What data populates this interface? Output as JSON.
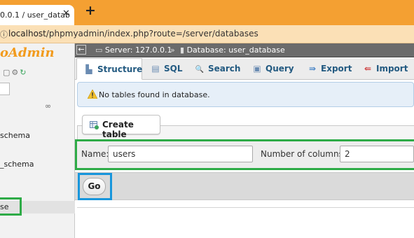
{
  "browser": {
    "tab_title": "0.0.1 / user_datab",
    "tab_close": "✕",
    "new_tab": "+",
    "url_icon": "ⓘ",
    "url_host": "localhost",
    "url_path": "/phpmyadmin/index.php?route=/server/databases"
  },
  "sidebar": {
    "logo": "oAdmin",
    "databases": [
      {
        "label": "schema"
      },
      {
        "label": "_schema"
      },
      {
        "label": "se",
        "selected": true
      }
    ]
  },
  "breadcrumb": {
    "collapse": "←",
    "server": "Server: 127.0.0.1",
    "sep": "»",
    "database": "Database: user_database"
  },
  "tabs": [
    {
      "label": "Structure",
      "icon": "structure-icon",
      "glyph": "▙",
      "active": true
    },
    {
      "label": "SQL",
      "icon": "sql-icon",
      "glyph": "▤",
      "active": false
    },
    {
      "label": "Search",
      "icon": "search-icon",
      "glyph": "🔍",
      "active": false
    },
    {
      "label": "Query",
      "icon": "query-icon",
      "glyph": "▣",
      "active": false
    },
    {
      "label": "Export",
      "icon": "export-icon",
      "glyph": "⇛",
      "active": false
    },
    {
      "label": "Import",
      "icon": "import-icon",
      "glyph": "⇚",
      "active": false
    }
  ],
  "notice": {
    "text": "No tables found in database."
  },
  "create_table": {
    "legend": "Create table",
    "name_label": "Name:",
    "name_value": "users",
    "columns_label": "Number of columns:",
    "columns_value": "2",
    "go_label": "Go"
  },
  "colors": {
    "tabbar": "#f4a032",
    "highlight_green": "#2eab47",
    "highlight_blue": "#1896dc",
    "link": "#235a81"
  }
}
